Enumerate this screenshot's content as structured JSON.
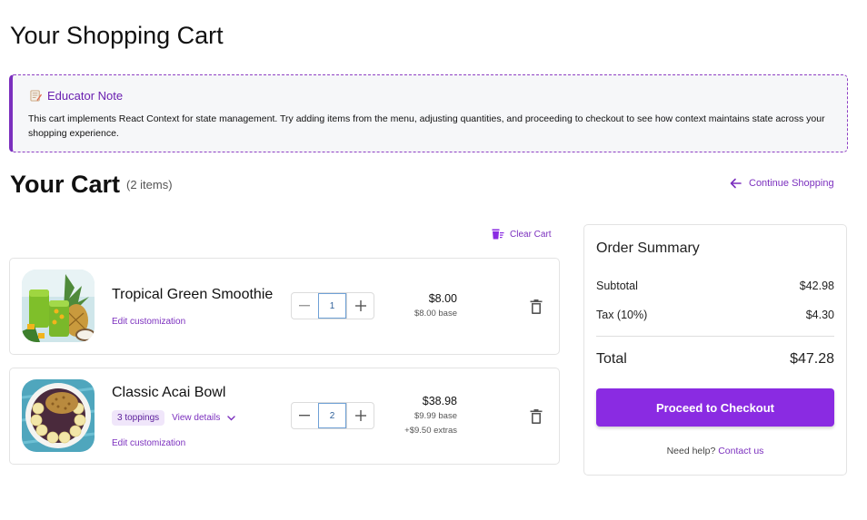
{
  "page": {
    "title": "Your Shopping Cart"
  },
  "note": {
    "title": "Educator Note",
    "icon": "memo-icon",
    "text": "This cart implements React Context for state management. Try adding items from the menu, adjusting quantities, and proceeding to checkout to see how context maintains state across your shopping experience."
  },
  "cart": {
    "heading": "Your Cart",
    "count": "(2 items)",
    "continue_label": "Continue Shopping",
    "clear_label": "Clear Cart"
  },
  "items": [
    {
      "name": "Tropical Green Smoothie",
      "edit_label": "Edit customization",
      "quantity": "1",
      "price": "$8.00",
      "base": "$8.00 base",
      "image": "green-smoothie-image"
    },
    {
      "name": "Classic Acai Bowl",
      "toppings_badge": "3 toppings",
      "view_details": "View details",
      "edit_label": "Edit customization",
      "quantity": "2",
      "price": "$38.98",
      "base": "$9.99 base",
      "extras": "+$9.50 extras",
      "image": "acai-bowl-image"
    }
  ],
  "summary": {
    "title": "Order Summary",
    "subtotal_label": "Subtotal",
    "subtotal_value": "$42.98",
    "tax_label": "Tax (10%)",
    "tax_value": "$4.30",
    "total_label": "Total",
    "total_value": "$47.28",
    "checkout_label": "Proceed to Checkout",
    "help_text": "Need help?",
    "contact_label": "Contact us"
  },
  "colors": {
    "accent": "#8a2be2",
    "link": "#7b2fbe"
  }
}
